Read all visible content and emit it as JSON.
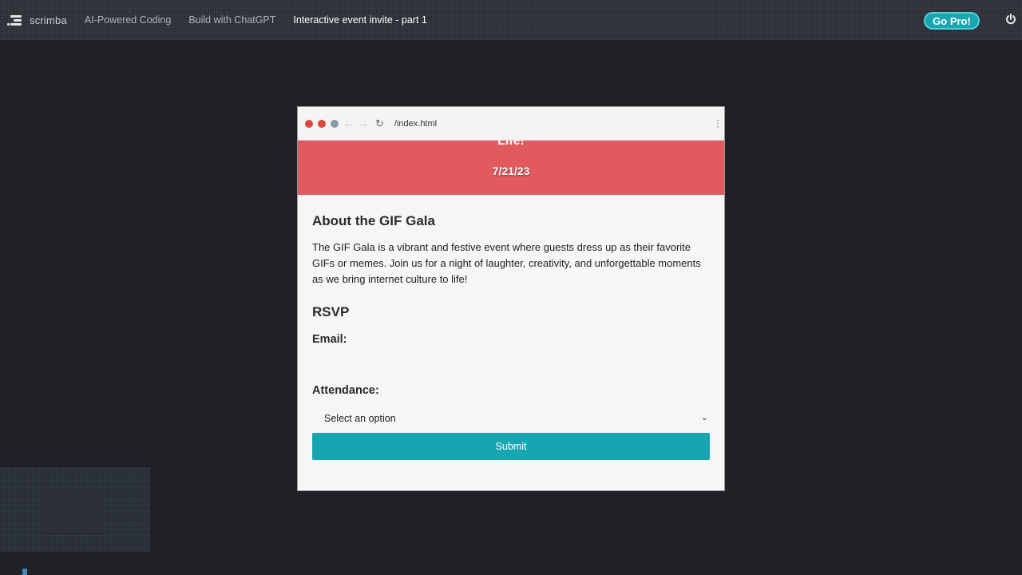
{
  "nav": {
    "logo_text": "scrimba",
    "breadcrumbs": [
      {
        "label": "AI-Powered Coding"
      },
      {
        "label": "Build with ChatGPT"
      },
      {
        "label": "Interactive event invite - part 1"
      }
    ],
    "go_pro_label": "Go Pro!"
  },
  "browser": {
    "url": "/index.html"
  },
  "page": {
    "hero_overflow_text": "Life!",
    "date": "7/21/23",
    "about_title": "About the GIF Gala",
    "about_text": "The GIF Gala is a vibrant and festive event where guests dress up as their favorite GIFs or memes. Join us for a night of laughter, creativity, and unforgettable moments as we bring internet culture to life!",
    "rsvp_title": "RSVP",
    "email_label": "Email:",
    "email_value": "",
    "attendance_label": "Attendance:",
    "attendance_selected": "Select an option",
    "submit_label": "Submit"
  },
  "colors": {
    "hero_bg": "#e05a60",
    "accent": "#18a5b2",
    "app_bg": "#1f2126"
  }
}
